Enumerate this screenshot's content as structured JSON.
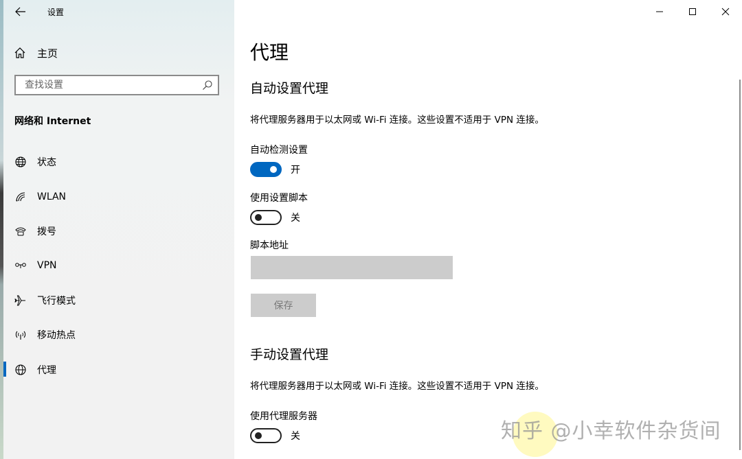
{
  "window": {
    "title": "设置",
    "controls": {
      "minimize": "minimize-icon",
      "maximize": "maximize-icon",
      "close": "close-icon"
    }
  },
  "sidebar": {
    "back_icon": "back-arrow-icon",
    "home_label": "主页",
    "search_placeholder": "查找设置",
    "section_title": "网络和 Internet",
    "items": [
      {
        "label": "状态",
        "icon": "globe-status-icon"
      },
      {
        "label": "WLAN",
        "icon": "wifi-icon"
      },
      {
        "label": "拨号",
        "icon": "dialup-icon"
      },
      {
        "label": "VPN",
        "icon": "vpn-icon"
      },
      {
        "label": "飞行模式",
        "icon": "airplane-icon"
      },
      {
        "label": "移动热点",
        "icon": "hotspot-icon"
      },
      {
        "label": "代理",
        "icon": "globe-icon",
        "active": true
      }
    ],
    "accent_color": "#0067c0"
  },
  "main": {
    "page_title": "代理",
    "auto": {
      "heading": "自动设置代理",
      "description": "将代理服务器用于以太网或 Wi-Fi 连接。这些设置不适用于 VPN 连接。",
      "detect_label": "自动检测设置",
      "detect_state": "开",
      "script_label": "使用设置脚本",
      "script_state": "关",
      "address_label": "脚本地址",
      "address_value": "",
      "save_label": "保存"
    },
    "manual": {
      "heading": "手动设置代理",
      "description": "将代理服务器用于以太网或 Wi-Fi 连接。这些设置不适用于 VPN 连接。",
      "use_proxy_label": "使用代理服务器",
      "use_proxy_state": "关"
    }
  },
  "watermark": "知乎 @小幸软件杂货间"
}
